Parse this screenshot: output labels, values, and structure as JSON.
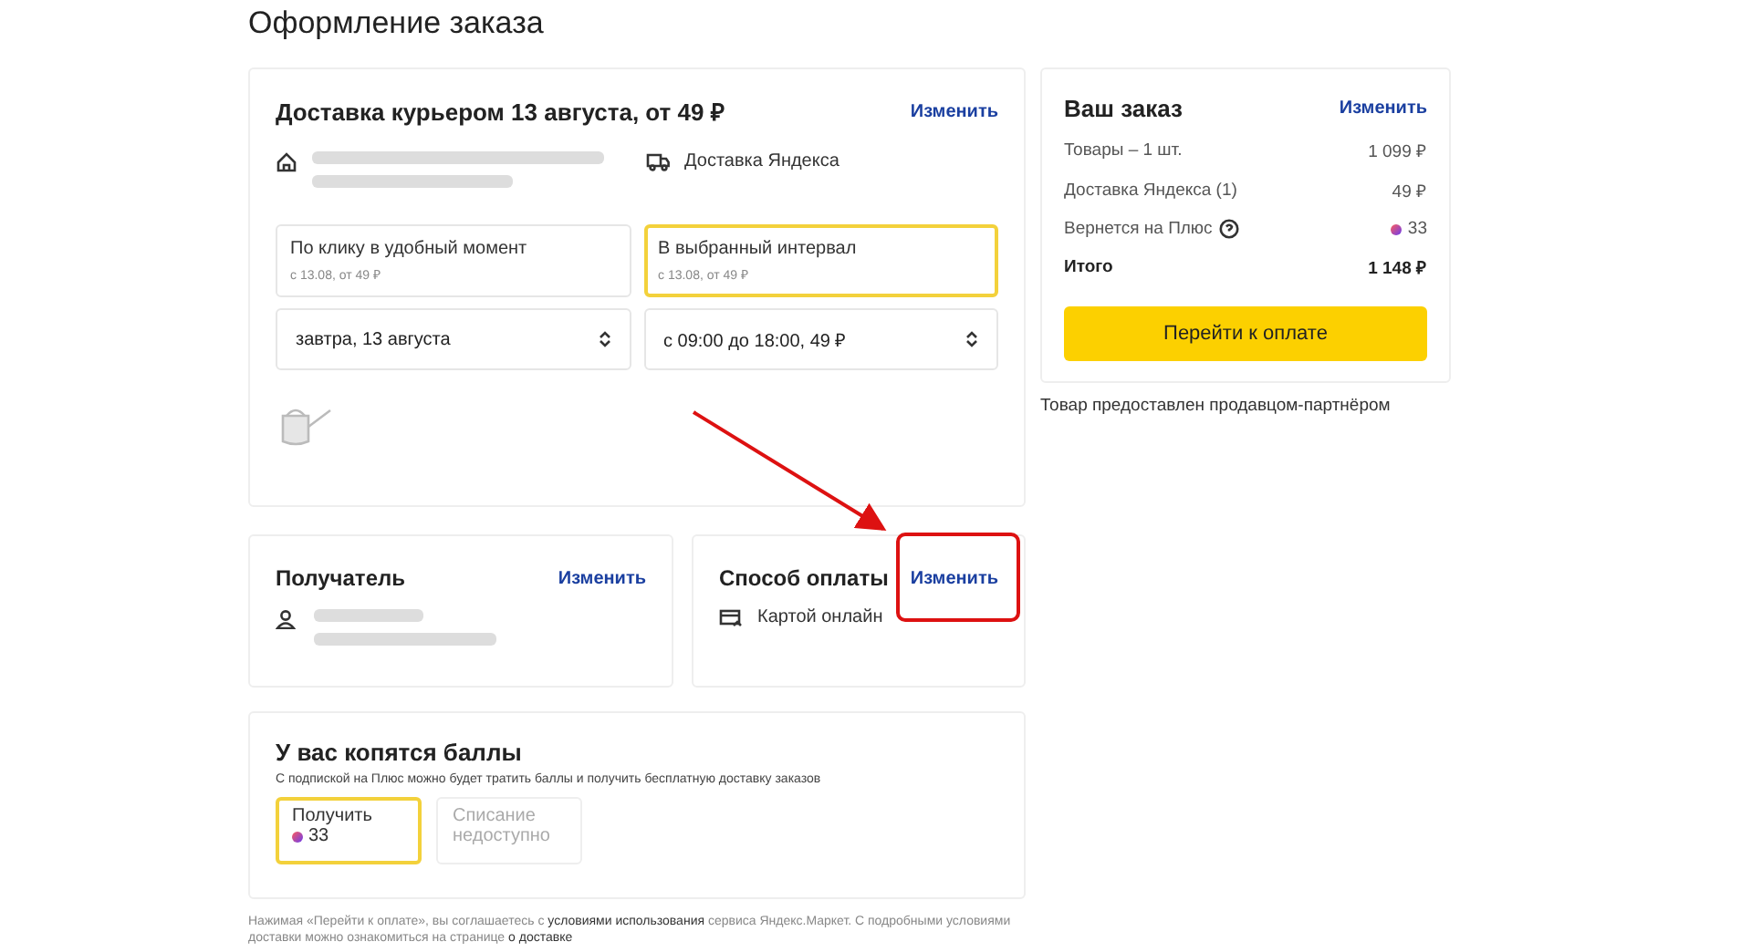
{
  "page_title": "Оформление заказа",
  "delivery": {
    "title": "Доставка курьером 13 августа, от 49 ₽",
    "change": "Изменить",
    "service": "Доставка Яндекса",
    "options": [
      {
        "label": "По клику в удобный момент",
        "note": "с 13.08, от 49 ₽",
        "selected": false
      },
      {
        "label": "В выбранный интервал",
        "note": "с 13.08, от 49 ₽",
        "selected": true
      }
    ],
    "selects": [
      "завтра, 13 августа",
      "с 09:00 до 18:00, 49 ₽"
    ]
  },
  "recipient": {
    "title": "Получатель",
    "change": "Изменить"
  },
  "payment": {
    "title": "Способ оплаты",
    "change": "Изменить",
    "method": "Картой онлайн"
  },
  "points": {
    "title": "У вас копятся баллы",
    "note": "С подпиской на Плюс можно будет тратить баллы и получить бесплатную доставку заказов",
    "options": [
      {
        "label": "Получить",
        "value": "33",
        "selected": true,
        "disabled": false
      },
      {
        "label": "Списание недоступно",
        "selected": false,
        "disabled": true
      }
    ]
  },
  "legal": {
    "parts": [
      "Нажимая «Перейти к оплате», вы соглашаетесь с ",
      "условиями использования",
      " сервиса Яндекс.Маркет. С подробными условиями доставки можно ознакомиться на странице ",
      "о доставке"
    ]
  },
  "order": {
    "title": "Ваш заказ",
    "change": "Изменить",
    "rows": [
      {
        "kind": "plain",
        "label": "Товары – 1 шт.",
        "value": "1 099 ₽"
      },
      {
        "kind": "plain",
        "label": "Доставка Яндекса (1)",
        "value": "49 ₽"
      },
      {
        "kind": "plus",
        "label": "Вернется на Плюс",
        "value": "33"
      },
      {
        "kind": "total",
        "label": "Итого",
        "value": "1 148 ₽"
      }
    ],
    "button": "Перейти к оплате",
    "seller_note": "Товар предоставлен продавцом-партнёром"
  }
}
